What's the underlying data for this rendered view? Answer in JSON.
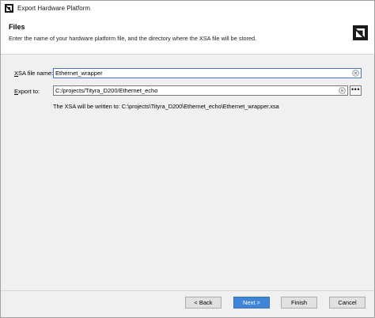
{
  "window": {
    "title": "Export Hardware Platform"
  },
  "header": {
    "title": "Files",
    "description": "Enter the name of your hardware platform file, and the directory where the XSA file will be stored.",
    "logo_icon": "amd-logo-icon"
  },
  "form": {
    "xsa_label_prefix": "X",
    "xsa_label_rest": "SA file name:",
    "xsa_value": "Ethernet_wrapper",
    "export_label_prefix": "E",
    "export_label_rest": "xport to:",
    "export_value": "C:/projects/Tityra_D200/Ethernet_echo",
    "browse_label": "•••",
    "info_text": "The XSA will be written to: C:\\projects\\Tityra_D200\\Ethernet_echo\\Ethernet_wrapper.xsa"
  },
  "buttons": {
    "back": "< Back",
    "next": "Next >",
    "finish": "Finish",
    "cancel": "Cancel"
  },
  "colors": {
    "primary_button": "#3f86d8",
    "focus_border": "#3f78c6"
  }
}
